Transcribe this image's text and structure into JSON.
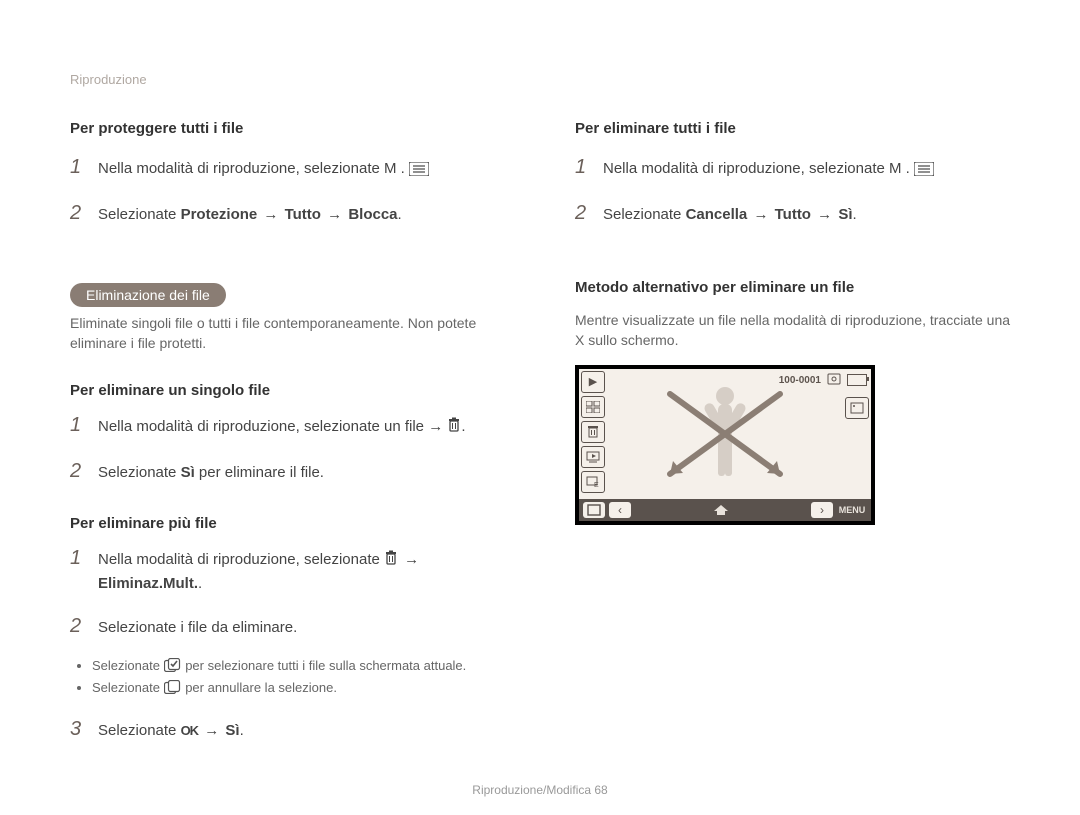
{
  "header": {
    "breadcrumb": "Riproduzione"
  },
  "left": {
    "protectAll": {
      "title": "Per proteggere tutti i ﬁle",
      "step1": "Nella modalità di riproduzione, selezionate M    .",
      "step2_pre": "Selezionate ",
      "step2_mid1": "Protezione",
      "step2_mid2": "Tutto",
      "step2_mid3": "Blocca",
      "step2_end": "."
    },
    "deleteSection": {
      "pill": "Eliminazione dei ﬁle",
      "body": "Eliminate singoli ﬁle o tutti i ﬁle contemporaneamente. Non potete eliminare i ﬁle protetti."
    },
    "deleteOne": {
      "title": "Per eliminare un singolo ﬁle",
      "step1": "Nella modalità di riproduzione, selezionate un ﬁle → ",
      "step2_pre": "Selezionate ",
      "step2_mid": "Sì",
      "step2_post": " per eliminare il ﬁle."
    },
    "deleteMany": {
      "title": "Per eliminare più ﬁle",
      "step1_pre": "Nella modalità di riproduzione, selezionate ",
      "step1_post": "Eliminaz.Mult.",
      "step2": "Selezionate i ﬁle da eliminare.",
      "bullet1_pre": "Selezionate ",
      "bullet1_post": " per selezionare tutti i ﬁle sulla schermata attuale.",
      "bullet2_pre": "Selezionate ",
      "bullet2_post": " per annullare la selezione.",
      "step3_pre": "Selezionate ",
      "step3_post": "Sì"
    }
  },
  "right": {
    "deleteAll": {
      "title": "Per eliminare tutti i ﬁle",
      "step1": "Nella modalità di riproduzione, selezionate M    .",
      "step2_pre": "Selezionate ",
      "step2_mid1": "Cancella",
      "step2_mid2": "Tutto",
      "step2_mid3": "Sì",
      "step2_end": "."
    },
    "altMethod": {
      "title": "Metodo alternativo per eliminare un ﬁle",
      "body": "Mentre visualizzate un ﬁle nella modalità di riproduzione, tracciate una X sullo schermo."
    },
    "lcd": {
      "counter": "100-0001",
      "menu_label": "MENU"
    }
  },
  "footer": {
    "text": "Riproduzione/Modiﬁca  68"
  },
  "icons": {
    "trash": "trash-icon",
    "check_all": "select-all-icon",
    "deselect": "deselect-icon",
    "ok": "OK"
  }
}
